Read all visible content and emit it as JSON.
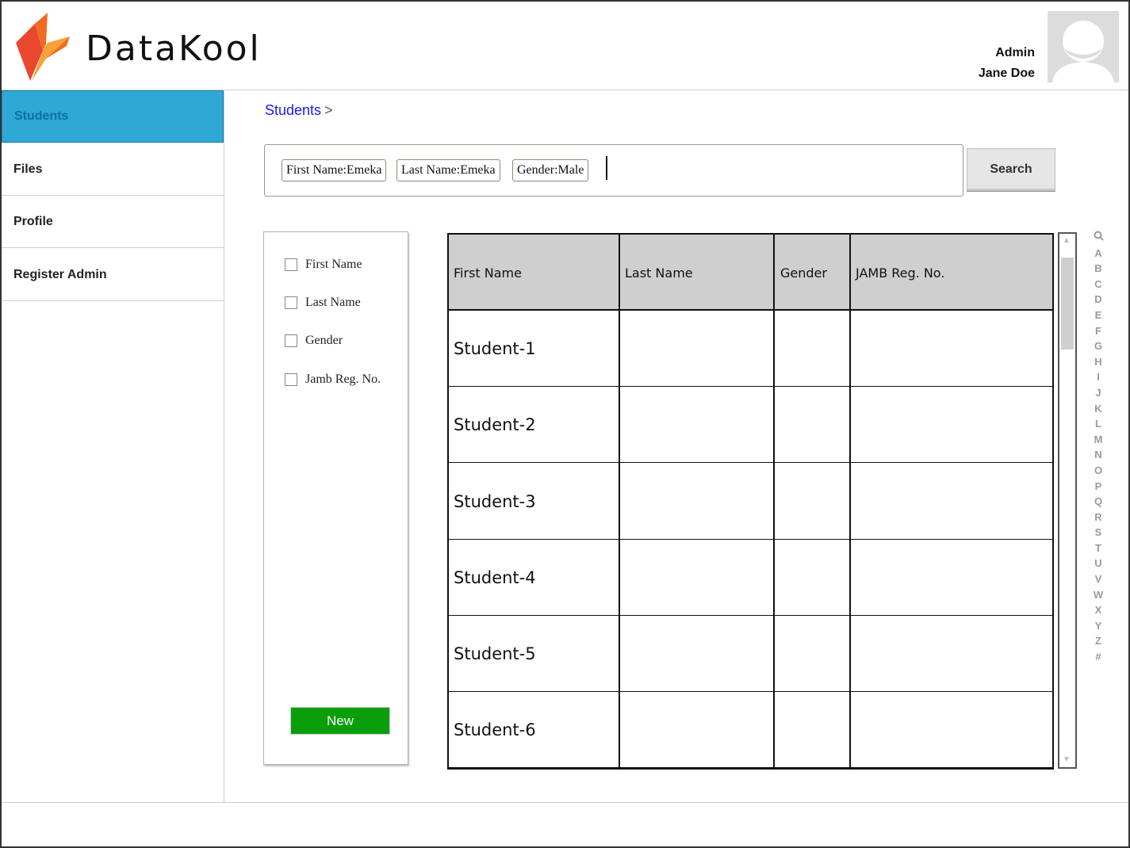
{
  "header": {
    "brand": "DataKool",
    "user_role": "Admin",
    "user_name": "Jane Doe",
    "logo_colors": [
      "#f26b21",
      "#f7a13a",
      "#e9472e"
    ]
  },
  "sidebar": {
    "items": [
      {
        "label": "Students",
        "active": true
      },
      {
        "label": "Files"
      },
      {
        "label": "Profile"
      },
      {
        "label": "Register Admin"
      }
    ]
  },
  "breadcrumb": {
    "current": "Students",
    "separator": ">"
  },
  "search": {
    "chips": [
      "First Name:Emeka",
      "Last Name:Emeka",
      "Gender:Male"
    ],
    "button_label": "Search"
  },
  "filters": {
    "options": [
      "First Name",
      "Last Name",
      "Gender",
      "Jamb Reg. No."
    ],
    "new_label": "New"
  },
  "table": {
    "columns": [
      "First Name",
      "Last Name",
      "Gender",
      "JAMB Reg. No."
    ],
    "rows": [
      [
        "Student-1",
        "",
        "",
        ""
      ],
      [
        "Student-2",
        "",
        "",
        ""
      ],
      [
        "Student-3",
        "",
        "",
        ""
      ],
      [
        "Student-4",
        "",
        "",
        ""
      ],
      [
        "Student-5",
        "",
        "",
        ""
      ],
      [
        "Student-6",
        "",
        "",
        ""
      ]
    ]
  },
  "alpha_index": [
    "A",
    "B",
    "C",
    "D",
    "E",
    "F",
    "G",
    "H",
    "I",
    "J",
    "K",
    "L",
    "M",
    "N",
    "O",
    "P",
    "Q",
    "R",
    "S",
    "T",
    "U",
    "V",
    "W",
    "X",
    "Y",
    "Z",
    "#"
  ],
  "colors": {
    "active_nav": "#2fa8d6",
    "new_button": "#0a9e0a",
    "link": "#1a1aee"
  },
  "icons": {
    "index_search": "search-icon"
  }
}
